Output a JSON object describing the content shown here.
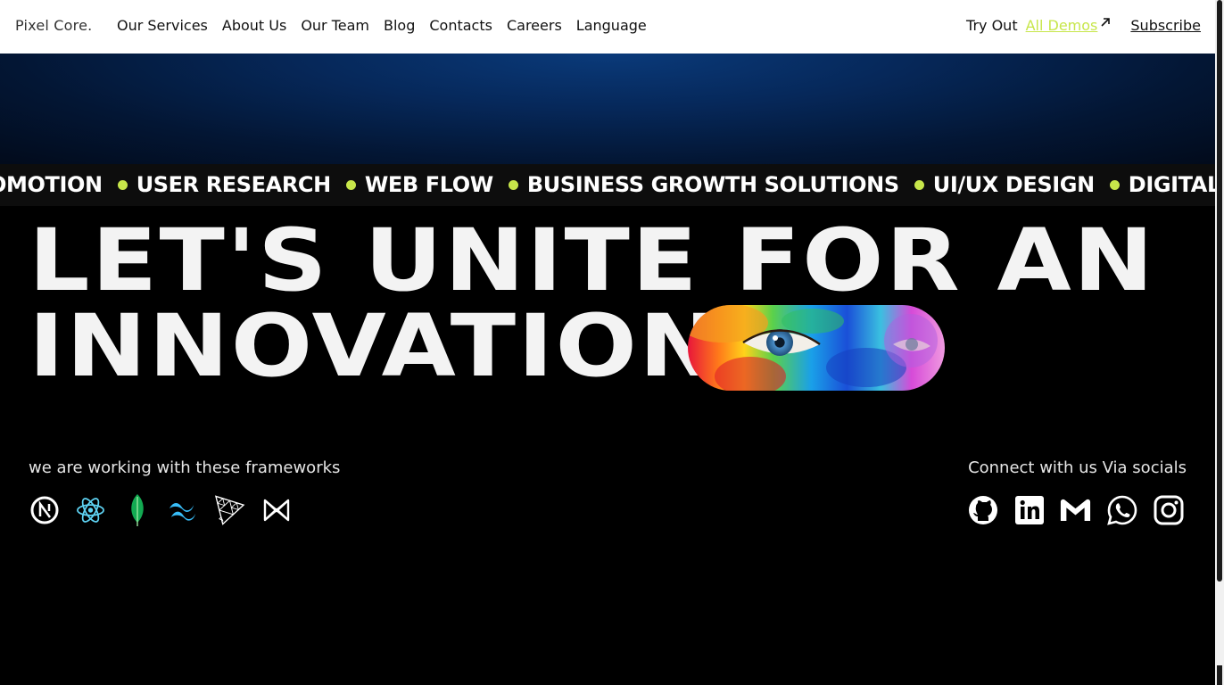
{
  "header": {
    "brand": "Pixel Core.",
    "nav": [
      "Our Services",
      "About Us",
      "Our Team",
      "Blog",
      "Contacts",
      "Careers",
      "Language"
    ],
    "try_out": "Try Out",
    "demos_link": "All Demos",
    "subscribe": "Subscribe"
  },
  "ticker": {
    "lead": "OMOTION",
    "items": [
      "USER RESEARCH",
      "WEB FLOW",
      "BUSINESS GROWTH SOLUTIONS",
      "UI/UX DESIGN",
      "DIGITAL MARKETING"
    ]
  },
  "hero": {
    "line1": "LET'S UNITE FOR AN",
    "line2": "INNOVATION"
  },
  "frameworks": {
    "label": "we are working with these frameworks",
    "icons": [
      "nextjs-icon",
      "react-icon",
      "mongodb-icon",
      "tailwind-icon",
      "threejs-icon",
      "framer-motion-icon"
    ]
  },
  "socials": {
    "label": "Connect with us Via socials",
    "icons": [
      "github-icon",
      "linkedin-icon",
      "gmail-icon",
      "whatsapp-icon",
      "instagram-icon"
    ]
  },
  "colors": {
    "accent": "#c7e64a",
    "background": "#000000",
    "hero_glow": "#0a3a7a"
  }
}
